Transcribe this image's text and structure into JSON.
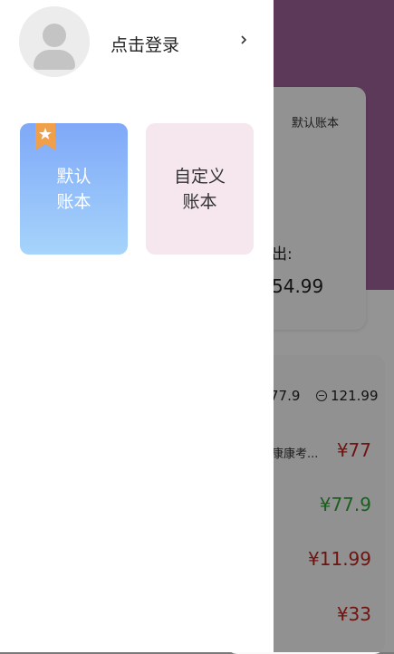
{
  "drawer": {
    "login_label": "点击登录",
    "books": [
      {
        "line1": "默认",
        "line2": "账本"
      },
      {
        "line1": "自定义",
        "line2": "账本"
      }
    ]
  },
  "background": {
    "card_title": "默认账本",
    "expense_label": "出:",
    "expense_value": "54.99",
    "summary_left": "77.9",
    "summary_right": "121.99",
    "row_name": "康康考...",
    "amounts": [
      "¥77",
      "¥77.9",
      "¥11.99",
      "¥33"
    ]
  },
  "colors": {
    "header": "#a0639a",
    "default_book_top": "#7fa8f8",
    "default_book_bottom": "#a6d4fb",
    "custom_book": "#f6e7ef",
    "bookmark": "#f0a04b",
    "expense_red": "#c2231d",
    "income_green": "#2aa532"
  },
  "icons": [
    "avatar-icon",
    "chevron-right-icon",
    "bookmark-star-icon",
    "minus-circle-icon"
  ]
}
